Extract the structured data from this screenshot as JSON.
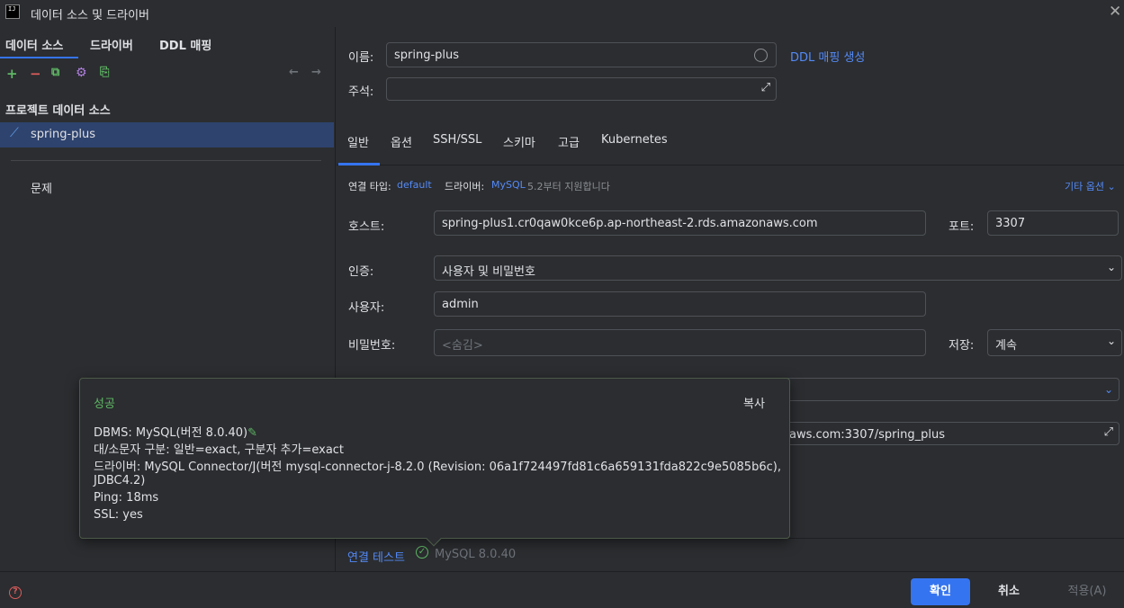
{
  "window": {
    "title": "데이터 소스 및 드라이버",
    "app_icon": "IJ"
  },
  "left_tabs": [
    "데이터 소스",
    "드라이버",
    "DDL 매핑"
  ],
  "left_section": "프로젝트 데이터 소스",
  "tree_item": "spring-plus",
  "problems_label": "문제",
  "name": {
    "label": "이름:",
    "value": "spring-plus",
    "ddl_link": "DDL 매핑 생성"
  },
  "comment": {
    "label": "주석:",
    "value": ""
  },
  "tabs": [
    "일반",
    "옵션",
    "SSH/SSL",
    "스키마",
    "고급",
    "Kubernetes"
  ],
  "conn": {
    "type_label": "연결 타입:",
    "type_value": "default",
    "driver_label": "드라이버:",
    "driver_value": "MySQL",
    "driver_note": "5.2부터 지원합니다",
    "more_options": "기타 옵션"
  },
  "host": {
    "label": "호스트:",
    "value": "spring-plus1.cr0qaw0kce6p.ap-northeast-2.rds.amazonaws.com"
  },
  "port": {
    "label": "포트:",
    "value": "3307"
  },
  "auth": {
    "label": "인증:",
    "value": "사용자 및 비밀번호"
  },
  "user": {
    "label": "사용자:",
    "value": "admin"
  },
  "password": {
    "label": "비밀번호:",
    "placeholder": "<숨김>",
    "save_label": "저장:",
    "save_value": "계속"
  },
  "url_value": "aws.com:3307/spring_plus",
  "popup": {
    "title": "성공",
    "copy": "복사",
    "lines": [
      "DBMS: MySQL(버전 8.0.40)",
      "대/소문자 구분: 일반=exact, 구분자 추가=exact",
      "드라이버: MySQL Connector/J(버전 mysql-connector-j-8.2.0 (Revision: 06a1f724497fd81c6a659131fda822c9e5085b6c), JDBC4.2)",
      "Ping: 18ms",
      "SSL: yes"
    ]
  },
  "test": {
    "label": "연결 테스트",
    "status": "MySQL 8.0.40"
  },
  "buttons": {
    "ok": "확인",
    "cancel": "취소",
    "apply": "적용(A)"
  },
  "colors": {
    "accent": "#3574f0",
    "success": "#5fb865",
    "link": "#548af7",
    "selection": "#2e436e"
  }
}
